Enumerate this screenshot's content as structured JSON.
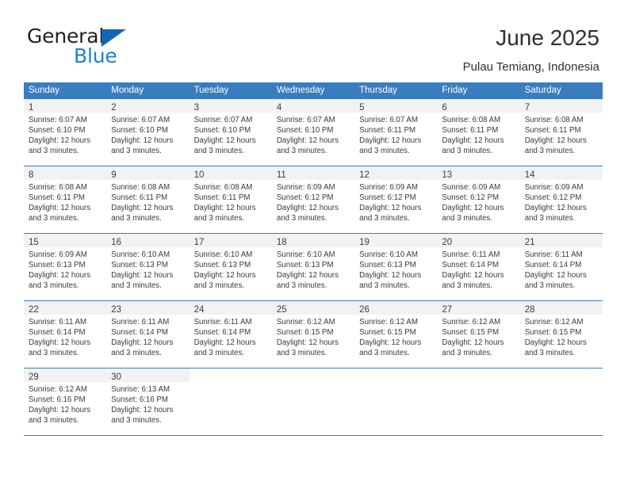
{
  "brand": {
    "name_part1": "General",
    "name_part2": "Blue",
    "triangle_color": "#1565b5",
    "blue_color": "#1b81d4"
  },
  "header": {
    "title": "June 2025",
    "subtitle": "Pulau Temiang, Indonesia"
  },
  "theme": {
    "header_row_bg": "#3a7cc0",
    "daynum_bg": "#f2f2f2",
    "separator": "#3a7cc0"
  },
  "weekdays": [
    "Sunday",
    "Monday",
    "Tuesday",
    "Wednesday",
    "Thursday",
    "Friday",
    "Saturday"
  ],
  "weeks": [
    [
      {
        "day": "1",
        "sunrise": "Sunrise: 6:07 AM",
        "sunset": "Sunset: 6:10 PM",
        "daylight": "Daylight: 12 hours and 3 minutes."
      },
      {
        "day": "2",
        "sunrise": "Sunrise: 6:07 AM",
        "sunset": "Sunset: 6:10 PM",
        "daylight": "Daylight: 12 hours and 3 minutes."
      },
      {
        "day": "3",
        "sunrise": "Sunrise: 6:07 AM",
        "sunset": "Sunset: 6:10 PM",
        "daylight": "Daylight: 12 hours and 3 minutes."
      },
      {
        "day": "4",
        "sunrise": "Sunrise: 6:07 AM",
        "sunset": "Sunset: 6:10 PM",
        "daylight": "Daylight: 12 hours and 3 minutes."
      },
      {
        "day": "5",
        "sunrise": "Sunrise: 6:07 AM",
        "sunset": "Sunset: 6:11 PM",
        "daylight": "Daylight: 12 hours and 3 minutes."
      },
      {
        "day": "6",
        "sunrise": "Sunrise: 6:08 AM",
        "sunset": "Sunset: 6:11 PM",
        "daylight": "Daylight: 12 hours and 3 minutes."
      },
      {
        "day": "7",
        "sunrise": "Sunrise: 6:08 AM",
        "sunset": "Sunset: 6:11 PM",
        "daylight": "Daylight: 12 hours and 3 minutes."
      }
    ],
    [
      {
        "day": "8",
        "sunrise": "Sunrise: 6:08 AM",
        "sunset": "Sunset: 6:11 PM",
        "daylight": "Daylight: 12 hours and 3 minutes."
      },
      {
        "day": "9",
        "sunrise": "Sunrise: 6:08 AM",
        "sunset": "Sunset: 6:11 PM",
        "daylight": "Daylight: 12 hours and 3 minutes."
      },
      {
        "day": "10",
        "sunrise": "Sunrise: 6:08 AM",
        "sunset": "Sunset: 6:11 PM",
        "daylight": "Daylight: 12 hours and 3 minutes."
      },
      {
        "day": "11",
        "sunrise": "Sunrise: 6:09 AM",
        "sunset": "Sunset: 6:12 PM",
        "daylight": "Daylight: 12 hours and 3 minutes."
      },
      {
        "day": "12",
        "sunrise": "Sunrise: 6:09 AM",
        "sunset": "Sunset: 6:12 PM",
        "daylight": "Daylight: 12 hours and 3 minutes."
      },
      {
        "day": "13",
        "sunrise": "Sunrise: 6:09 AM",
        "sunset": "Sunset: 6:12 PM",
        "daylight": "Daylight: 12 hours and 3 minutes."
      },
      {
        "day": "14",
        "sunrise": "Sunrise: 6:09 AM",
        "sunset": "Sunset: 6:12 PM",
        "daylight": "Daylight: 12 hours and 3 minutes."
      }
    ],
    [
      {
        "day": "15",
        "sunrise": "Sunrise: 6:09 AM",
        "sunset": "Sunset: 6:13 PM",
        "daylight": "Daylight: 12 hours and 3 minutes."
      },
      {
        "day": "16",
        "sunrise": "Sunrise: 6:10 AM",
        "sunset": "Sunset: 6:13 PM",
        "daylight": "Daylight: 12 hours and 3 minutes."
      },
      {
        "day": "17",
        "sunrise": "Sunrise: 6:10 AM",
        "sunset": "Sunset: 6:13 PM",
        "daylight": "Daylight: 12 hours and 3 minutes."
      },
      {
        "day": "18",
        "sunrise": "Sunrise: 6:10 AM",
        "sunset": "Sunset: 6:13 PM",
        "daylight": "Daylight: 12 hours and 3 minutes."
      },
      {
        "day": "19",
        "sunrise": "Sunrise: 6:10 AM",
        "sunset": "Sunset: 6:13 PM",
        "daylight": "Daylight: 12 hours and 3 minutes."
      },
      {
        "day": "20",
        "sunrise": "Sunrise: 6:11 AM",
        "sunset": "Sunset: 6:14 PM",
        "daylight": "Daylight: 12 hours and 3 minutes."
      },
      {
        "day": "21",
        "sunrise": "Sunrise: 6:11 AM",
        "sunset": "Sunset: 6:14 PM",
        "daylight": "Daylight: 12 hours and 3 minutes."
      }
    ],
    [
      {
        "day": "22",
        "sunrise": "Sunrise: 6:11 AM",
        "sunset": "Sunset: 6:14 PM",
        "daylight": "Daylight: 12 hours and 3 minutes."
      },
      {
        "day": "23",
        "sunrise": "Sunrise: 6:11 AM",
        "sunset": "Sunset: 6:14 PM",
        "daylight": "Daylight: 12 hours and 3 minutes."
      },
      {
        "day": "24",
        "sunrise": "Sunrise: 6:11 AM",
        "sunset": "Sunset: 6:14 PM",
        "daylight": "Daylight: 12 hours and 3 minutes."
      },
      {
        "day": "25",
        "sunrise": "Sunrise: 6:12 AM",
        "sunset": "Sunset: 6:15 PM",
        "daylight": "Daylight: 12 hours and 3 minutes."
      },
      {
        "day": "26",
        "sunrise": "Sunrise: 6:12 AM",
        "sunset": "Sunset: 6:15 PM",
        "daylight": "Daylight: 12 hours and 3 minutes."
      },
      {
        "day": "27",
        "sunrise": "Sunrise: 6:12 AM",
        "sunset": "Sunset: 6:15 PM",
        "daylight": "Daylight: 12 hours and 3 minutes."
      },
      {
        "day": "28",
        "sunrise": "Sunrise: 6:12 AM",
        "sunset": "Sunset: 6:15 PM",
        "daylight": "Daylight: 12 hours and 3 minutes."
      }
    ],
    [
      {
        "day": "29",
        "sunrise": "Sunrise: 6:12 AM",
        "sunset": "Sunset: 6:16 PM",
        "daylight": "Daylight: 12 hours and 3 minutes."
      },
      {
        "day": "30",
        "sunrise": "Sunrise: 6:13 AM",
        "sunset": "Sunset: 6:16 PM",
        "daylight": "Daylight: 12 hours and 3 minutes."
      },
      null,
      null,
      null,
      null,
      null
    ]
  ]
}
